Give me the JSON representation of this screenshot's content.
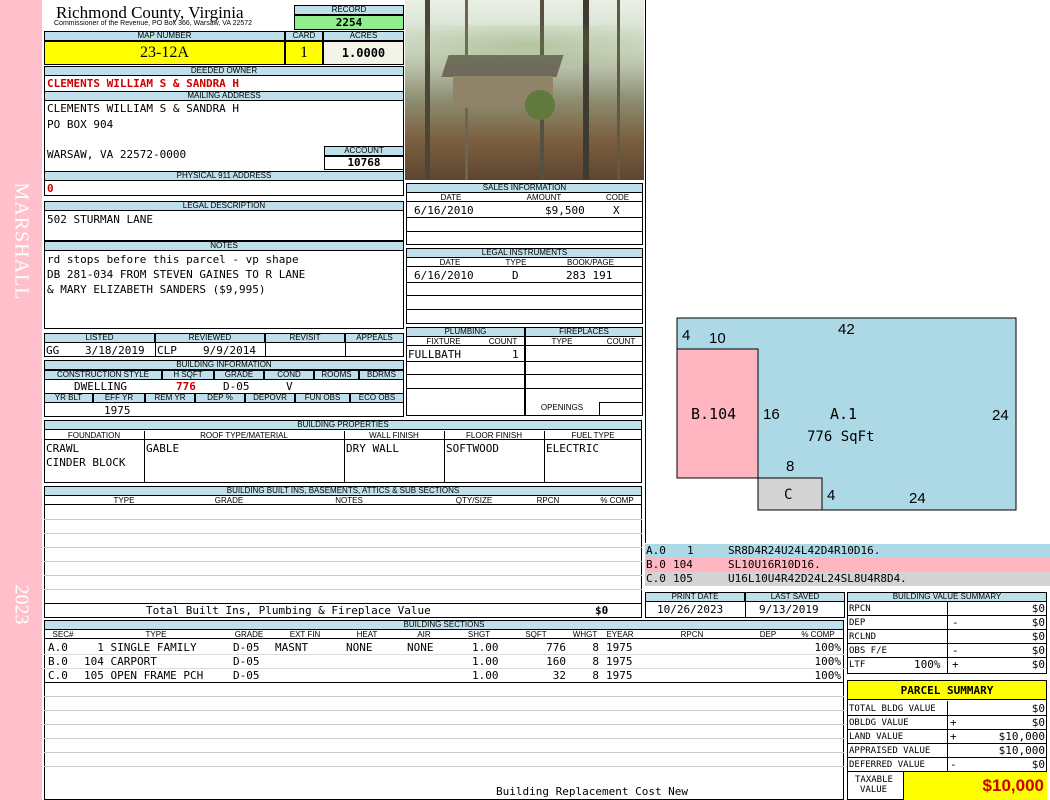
{
  "sidebar": {
    "name": "MARSHALL",
    "year": "2023"
  },
  "header": {
    "county": "Richmond County, Virginia",
    "commissioner": "Commissioner of the Revenue, PO Box 366, Warsaw, VA 22572",
    "record_label": "RECORD",
    "record": "2254",
    "map_label": "MAP NUMBER",
    "map": "23-12A",
    "card_label": "CARD",
    "card": "1",
    "acres_label": "ACRES",
    "acres": "1.0000"
  },
  "owner": {
    "deeded_label": "DEEDED OWNER",
    "deeded": "CLEMENTS WILLIAM S & SANDRA H",
    "mailing_label": "MAILING ADDRESS",
    "mailing_line1": "CLEMENTS WILLIAM S & SANDRA H",
    "mailing_line2": "PO BOX 904",
    "mailing_line3": "WARSAW, VA 22572-0000",
    "account_label": "ACCOUNT",
    "account": "10768",
    "physical_label": "PHYSICAL 911 ADDRESS",
    "physical": "0"
  },
  "legal": {
    "label": "LEGAL DESCRIPTION",
    "text": "502 STURMAN LANE"
  },
  "notes": {
    "label": "NOTES",
    "line1": "rd stops before this parcel - vp shape",
    "line2": "DB 281-034 FROM STEVEN GAINES TO R LANE",
    "line3": "& MARY ELIZABETH SANDERS ($9,995)"
  },
  "listed": {
    "listed_label": "LISTED",
    "reviewed_label": "REVIEWED",
    "revisit_label": "REVISIT",
    "appeals_label": "APPEALS",
    "listed_by": "GG",
    "listed_date": "3/18/2019",
    "reviewed_by": "CLP",
    "reviewed_date": "9/9/2014"
  },
  "building_info": {
    "label": "BUILDING INFORMATION",
    "h_const": "CONSTRUCTION STYLE",
    "h_hsqft": "H SQFT",
    "h_grade": "GRADE",
    "h_cond": "COND",
    "h_rooms": "ROOMS",
    "h_bdrms": "BDRMS",
    "style": "DWELLING",
    "hsqft": "776",
    "grade": "D-05",
    "cond": "V",
    "h_yrblt": "YR BLT",
    "h_effyr": "EFF YR",
    "h_remyr": "REM YR",
    "h_dep": "DEP %",
    "h_depovr": "DEPOVR",
    "h_funobs": "FUN OBS",
    "h_ecoobs": "ECO OBS",
    "effyr": "1975"
  },
  "sales": {
    "label": "SALES INFORMATION",
    "h_date": "DATE",
    "h_amount": "AMOUNT",
    "h_code": "CODE",
    "date": "6/16/2010",
    "amount": "$9,500",
    "code": "X"
  },
  "legal_instruments": {
    "label": "LEGAL INSTRUMENTS",
    "h_date": "DATE",
    "h_type": "TYPE",
    "h_book": "BOOK/PAGE",
    "date": "6/16/2010",
    "type": "D",
    "book": "283 191"
  },
  "plumbing": {
    "label": "PLUMBING",
    "h_fixture": "FIXTURE",
    "h_count": "COUNT",
    "fixture": "FULLBATH",
    "count": "1"
  },
  "fireplaces": {
    "label": "FIREPLACES",
    "h_type": "TYPE",
    "h_count": "COUNT",
    "openings": "OPENINGS"
  },
  "properties": {
    "label": "BUILDING PROPERTIES",
    "h_foundation": "FOUNDATION",
    "h_roof": "ROOF TYPE/MATERIAL",
    "h_wall": "WALL FINISH",
    "h_floor": "FLOOR FINISH",
    "h_fuel": "FUEL TYPE",
    "foundation1": "CRAWL",
    "foundation2": "CINDER BLOCK",
    "roof": "GABLE",
    "wall": "DRY WALL",
    "floor": "SOFTWOOD",
    "fuel": "ELECTRIC"
  },
  "builtins": {
    "label": "BUILDING BUILT INS, BASEMENTS, ATTICS & SUB SECTIONS",
    "h_type": "TYPE",
    "h_grade": "GRADE",
    "h_notes": "NOTES",
    "h_qty": "QTY/SIZE",
    "h_rpcn": "RPCN",
    "h_comp": "% COMP",
    "total_label": "Total Built Ins, Plumbing & Fireplace Value",
    "total": "$0"
  },
  "sketch": {
    "labels": {
      "t4": "4",
      "t10": "10",
      "t42": "42",
      "b104": "B.104",
      "t16": "16",
      "a1": "A.1",
      "sqft": "776 SqFt",
      "t24r": "24",
      "t8": "8",
      "c": "C",
      "t4b": "4",
      "t24b": "24"
    },
    "legend": [
      {
        "sec": "A.0",
        "code": "1",
        "path": "SR8D4R24U24L42D4R10D16.",
        "color": "#add8e6"
      },
      {
        "sec": "B.0",
        "code": "104",
        "path": "SL10U16R10D16.",
        "color": "#ffb6c1"
      },
      {
        "sec": "C.0",
        "code": "105",
        "path": "U16L10U4R42D24L24SL8U4R8D4.",
        "color": "#d3d3d3"
      }
    ]
  },
  "dates": {
    "print_label": "PRINT DATE",
    "print": "10/26/2023",
    "saved_label": "LAST SAVED",
    "saved": "9/13/2019"
  },
  "sections": {
    "label": "BUILDING SECTIONS",
    "headers": [
      "SEC#",
      "TYPE",
      "GRADE",
      "EXT FIN",
      "HEAT",
      "AIR",
      "SHGT",
      "SQFT",
      "WHGT",
      "EYEAR",
      "RPCN",
      "DEP",
      "% COMP"
    ],
    "rows": [
      {
        "sec": "A.0",
        "type": "  1 SINGLE FAMILY",
        "grade": "D-05",
        "ext": "MASNT",
        "heat": "NONE",
        "air": "NONE",
        "shgt": "1.00",
        "sqft": "776",
        "whgt": "8",
        "eyear": "1975",
        "comp": "100%"
      },
      {
        "sec": "B.0",
        "type": "104 CARPORT",
        "grade": "D-05",
        "ext": "",
        "heat": "",
        "air": "",
        "shgt": "1.00",
        "sqft": "160",
        "whgt": "8",
        "eyear": "1975",
        "comp": "100%"
      },
      {
        "sec": "C.0",
        "type": "105 OPEN FRAME PCH",
        "grade": "D-05",
        "ext": "",
        "heat": "",
        "air": "",
        "shgt": "1.00",
        "sqft": "32",
        "whgt": "8",
        "eyear": "1975",
        "comp": "100%"
      }
    ],
    "footer": "Building Replacement Cost New"
  },
  "value_summary": {
    "label": "BUILDING VALUE SUMMARY",
    "rpcn_label": "RPCN",
    "rpcn": "$0",
    "dep_label": "DEP",
    "dep_op": "-",
    "dep": "$0",
    "rclnd_label": "RCLND",
    "rclnd": "$0",
    "obs_label": "OBS F/E",
    "obs_op": "-",
    "obs": "$0",
    "ltf_label": "LTF",
    "ltf_pct": "100%",
    "ltf_op": "+",
    "ltf": "$0"
  },
  "parcel": {
    "label": "PARCEL SUMMARY",
    "bldg_label": "TOTAL BLDG VALUE",
    "bldg": "$0",
    "obldg_label": "OBLDG VALUE",
    "obldg_op": "+",
    "obldg": "$0",
    "land_label": "LAND VALUE",
    "land_op": "+",
    "land": "$10,000",
    "appraised_label": "APPRAISED VALUE",
    "appraised": "$10,000",
    "deferred_label": "DEFERRED VALUE",
    "deferred_op": "-",
    "deferred": "$0",
    "taxable_label1": "TAXABLE",
    "taxable_label2": "VALUE",
    "taxable": "$10,000"
  }
}
